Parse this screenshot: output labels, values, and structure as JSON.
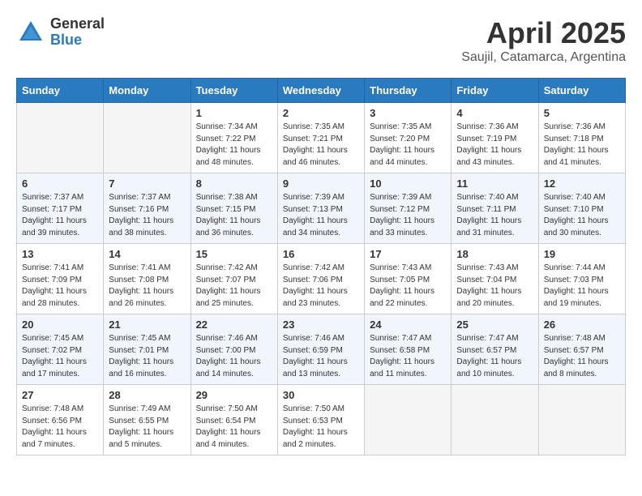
{
  "logo": {
    "general": "General",
    "blue": "Blue"
  },
  "title": "April 2025",
  "location": "Saujil, Catamarca, Argentina",
  "weekdays": [
    "Sunday",
    "Monday",
    "Tuesday",
    "Wednesday",
    "Thursday",
    "Friday",
    "Saturday"
  ],
  "weeks": [
    [
      {
        "day": "",
        "empty": true
      },
      {
        "day": "",
        "empty": true
      },
      {
        "day": "1",
        "sunrise": "Sunrise: 7:34 AM",
        "sunset": "Sunset: 7:22 PM",
        "daylight": "Daylight: 11 hours and 48 minutes."
      },
      {
        "day": "2",
        "sunrise": "Sunrise: 7:35 AM",
        "sunset": "Sunset: 7:21 PM",
        "daylight": "Daylight: 11 hours and 46 minutes."
      },
      {
        "day": "3",
        "sunrise": "Sunrise: 7:35 AM",
        "sunset": "Sunset: 7:20 PM",
        "daylight": "Daylight: 11 hours and 44 minutes."
      },
      {
        "day": "4",
        "sunrise": "Sunrise: 7:36 AM",
        "sunset": "Sunset: 7:19 PM",
        "daylight": "Daylight: 11 hours and 43 minutes."
      },
      {
        "day": "5",
        "sunrise": "Sunrise: 7:36 AM",
        "sunset": "Sunset: 7:18 PM",
        "daylight": "Daylight: 11 hours and 41 minutes."
      }
    ],
    [
      {
        "day": "6",
        "sunrise": "Sunrise: 7:37 AM",
        "sunset": "Sunset: 7:17 PM",
        "daylight": "Daylight: 11 hours and 39 minutes."
      },
      {
        "day": "7",
        "sunrise": "Sunrise: 7:37 AM",
        "sunset": "Sunset: 7:16 PM",
        "daylight": "Daylight: 11 hours and 38 minutes."
      },
      {
        "day": "8",
        "sunrise": "Sunrise: 7:38 AM",
        "sunset": "Sunset: 7:15 PM",
        "daylight": "Daylight: 11 hours and 36 minutes."
      },
      {
        "day": "9",
        "sunrise": "Sunrise: 7:39 AM",
        "sunset": "Sunset: 7:13 PM",
        "daylight": "Daylight: 11 hours and 34 minutes."
      },
      {
        "day": "10",
        "sunrise": "Sunrise: 7:39 AM",
        "sunset": "Sunset: 7:12 PM",
        "daylight": "Daylight: 11 hours and 33 minutes."
      },
      {
        "day": "11",
        "sunrise": "Sunrise: 7:40 AM",
        "sunset": "Sunset: 7:11 PM",
        "daylight": "Daylight: 11 hours and 31 minutes."
      },
      {
        "day": "12",
        "sunrise": "Sunrise: 7:40 AM",
        "sunset": "Sunset: 7:10 PM",
        "daylight": "Daylight: 11 hours and 30 minutes."
      }
    ],
    [
      {
        "day": "13",
        "sunrise": "Sunrise: 7:41 AM",
        "sunset": "Sunset: 7:09 PM",
        "daylight": "Daylight: 11 hours and 28 minutes."
      },
      {
        "day": "14",
        "sunrise": "Sunrise: 7:41 AM",
        "sunset": "Sunset: 7:08 PM",
        "daylight": "Daylight: 11 hours and 26 minutes."
      },
      {
        "day": "15",
        "sunrise": "Sunrise: 7:42 AM",
        "sunset": "Sunset: 7:07 PM",
        "daylight": "Daylight: 11 hours and 25 minutes."
      },
      {
        "day": "16",
        "sunrise": "Sunrise: 7:42 AM",
        "sunset": "Sunset: 7:06 PM",
        "daylight": "Daylight: 11 hours and 23 minutes."
      },
      {
        "day": "17",
        "sunrise": "Sunrise: 7:43 AM",
        "sunset": "Sunset: 7:05 PM",
        "daylight": "Daylight: 11 hours and 22 minutes."
      },
      {
        "day": "18",
        "sunrise": "Sunrise: 7:43 AM",
        "sunset": "Sunset: 7:04 PM",
        "daylight": "Daylight: 11 hours and 20 minutes."
      },
      {
        "day": "19",
        "sunrise": "Sunrise: 7:44 AM",
        "sunset": "Sunset: 7:03 PM",
        "daylight": "Daylight: 11 hours and 19 minutes."
      }
    ],
    [
      {
        "day": "20",
        "sunrise": "Sunrise: 7:45 AM",
        "sunset": "Sunset: 7:02 PM",
        "daylight": "Daylight: 11 hours and 17 minutes."
      },
      {
        "day": "21",
        "sunrise": "Sunrise: 7:45 AM",
        "sunset": "Sunset: 7:01 PM",
        "daylight": "Daylight: 11 hours and 16 minutes."
      },
      {
        "day": "22",
        "sunrise": "Sunrise: 7:46 AM",
        "sunset": "Sunset: 7:00 PM",
        "daylight": "Daylight: 11 hours and 14 minutes."
      },
      {
        "day": "23",
        "sunrise": "Sunrise: 7:46 AM",
        "sunset": "Sunset: 6:59 PM",
        "daylight": "Daylight: 11 hours and 13 minutes."
      },
      {
        "day": "24",
        "sunrise": "Sunrise: 7:47 AM",
        "sunset": "Sunset: 6:58 PM",
        "daylight": "Daylight: 11 hours and 11 minutes."
      },
      {
        "day": "25",
        "sunrise": "Sunrise: 7:47 AM",
        "sunset": "Sunset: 6:57 PM",
        "daylight": "Daylight: 11 hours and 10 minutes."
      },
      {
        "day": "26",
        "sunrise": "Sunrise: 7:48 AM",
        "sunset": "Sunset: 6:57 PM",
        "daylight": "Daylight: 11 hours and 8 minutes."
      }
    ],
    [
      {
        "day": "27",
        "sunrise": "Sunrise: 7:48 AM",
        "sunset": "Sunset: 6:56 PM",
        "daylight": "Daylight: 11 hours and 7 minutes."
      },
      {
        "day": "28",
        "sunrise": "Sunrise: 7:49 AM",
        "sunset": "Sunset: 6:55 PM",
        "daylight": "Daylight: 11 hours and 5 minutes."
      },
      {
        "day": "29",
        "sunrise": "Sunrise: 7:50 AM",
        "sunset": "Sunset: 6:54 PM",
        "daylight": "Daylight: 11 hours and 4 minutes."
      },
      {
        "day": "30",
        "sunrise": "Sunrise: 7:50 AM",
        "sunset": "Sunset: 6:53 PM",
        "daylight": "Daylight: 11 hours and 2 minutes."
      },
      {
        "day": "",
        "empty": true
      },
      {
        "day": "",
        "empty": true
      },
      {
        "day": "",
        "empty": true
      }
    ]
  ]
}
